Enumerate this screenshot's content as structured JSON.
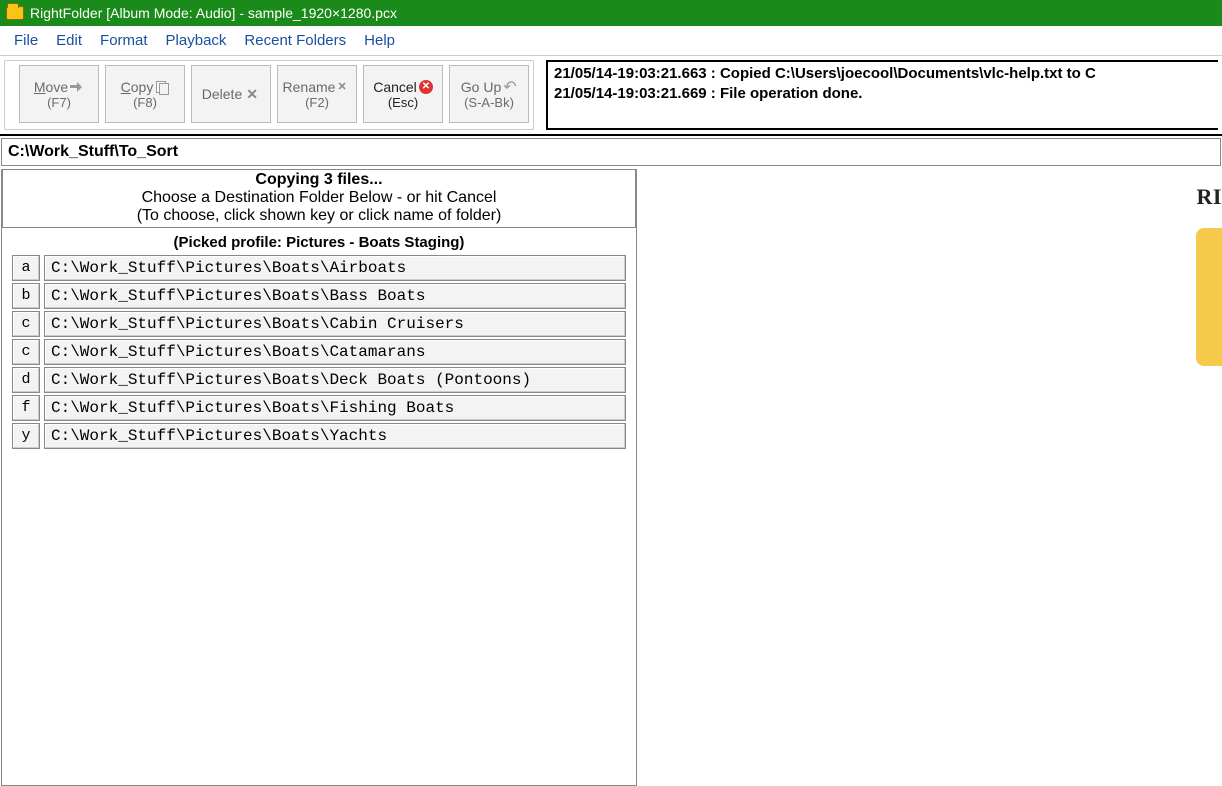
{
  "window": {
    "title": "RightFolder [Album Mode: Audio] - sample_1920×1280.pcx"
  },
  "menu": {
    "file": "File",
    "edit": "Edit",
    "format": "Format",
    "playback": "Playback",
    "recent": "Recent Folders",
    "help": "Help"
  },
  "toolbar": {
    "move": {
      "label": "Move",
      "accel_first": "M",
      "accel_rest": "ove",
      "shortcut": "(F7)"
    },
    "copy": {
      "label": "Copy",
      "accel_first": "C",
      "accel_rest": "opy",
      "shortcut": "(F8)"
    },
    "delete": {
      "label": "Delete",
      "shortcut": ""
    },
    "rename": {
      "label": "Rename",
      "shortcut": "(F2)"
    },
    "cancel": {
      "label": "Cancel",
      "shortcut": "(Esc)"
    },
    "goup": {
      "label": "Go Up",
      "shortcut": "(S-A-Bk)"
    }
  },
  "log": {
    "line1": "21/05/14-19:03:21.663 : Copied C:\\Users\\joecool\\Documents\\vlc-help.txt to C",
    "line2": "21/05/14-19:03:21.669 : File operation done."
  },
  "pathbar": "C:\\Work_Stuff\\To_Sort",
  "dest": {
    "heading_bold": "Copying 3 files...",
    "heading_line2": "Choose a Destination Folder Below - or hit Cancel",
    "heading_line3": "(To choose, click shown key or click name of folder)",
    "profile": "(Picked profile: Pictures - Boats Staging)",
    "rows": [
      {
        "key": "a",
        "path": "C:\\Work_Stuff\\Pictures\\Boats\\Airboats"
      },
      {
        "key": "b",
        "path": "C:\\Work_Stuff\\Pictures\\Boats\\Bass Boats"
      },
      {
        "key": "c",
        "path": "C:\\Work_Stuff\\Pictures\\Boats\\Cabin Cruisers"
      },
      {
        "key": "c",
        "path": "C:\\Work_Stuff\\Pictures\\Boats\\Catamarans"
      },
      {
        "key": "d",
        "path": "C:\\Work_Stuff\\Pictures\\Boats\\Deck Boats (Pontoons)"
      },
      {
        "key": "f",
        "path": "C:\\Work_Stuff\\Pictures\\Boats\\Fishing Boats"
      },
      {
        "key": "y",
        "path": "C:\\Work_Stuff\\Pictures\\Boats\\Yachts"
      }
    ]
  },
  "rightpane": {
    "cut_text": "RI"
  }
}
